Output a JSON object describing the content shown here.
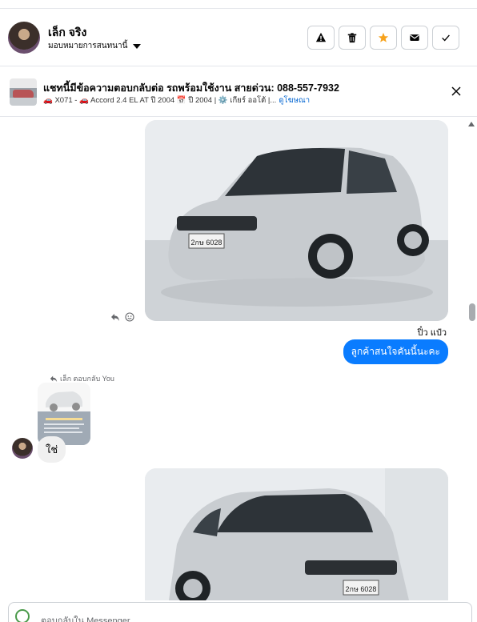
{
  "header": {
    "contact_name": "เล็ก จริง",
    "assign_label": "มอบหมายการสนทนานี้",
    "actions": [
      {
        "name": "report",
        "icon": "warning-icon"
      },
      {
        "name": "delete",
        "icon": "trash-icon"
      },
      {
        "name": "star",
        "icon": "star-icon",
        "color": "#f7a21b"
      },
      {
        "name": "mark-unread",
        "icon": "envelope-icon"
      },
      {
        "name": "done",
        "icon": "check-icon"
      }
    ]
  },
  "banner": {
    "title": "แชทนี้มีข้อความตอบกลับต่อ รถพร้อมใช้งาน สายด่วน: 088-557-7932",
    "details": "🚗 X071 - 🚗 Accord 2.4 EL AT ปี 2004 📅 ปี 2004 | ⚙️ เกียร์ ออโต้ |...",
    "link": "ดูโฆษณา"
  },
  "thread": {
    "outgoing_sender": "ปิ๋ว แป๋ว",
    "outgoing_message": "ลูกค้าสนใจคันนี้นะคะ",
    "reply_tag": "เล็ก ตอบกลับ You",
    "incoming_message": "ใช่",
    "car_plate_1": "2กษ 6028",
    "car_plate_2": "2กษ 6028"
  },
  "composer": {
    "placeholder": "ตอบกลับใน Messenger..."
  },
  "colors": {
    "accent": "#0a7cff",
    "star": "#f7a21b"
  }
}
